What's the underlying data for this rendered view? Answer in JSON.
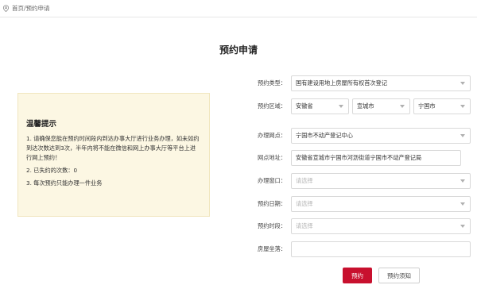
{
  "breadcrumb": {
    "home": "首页",
    "separator": "/",
    "current": "预约申请"
  },
  "page": {
    "title": "预约申请"
  },
  "notice": {
    "title": "温馨提示",
    "items": [
      "1. 请确保您能在预约时间段内到达办事大厅进行业务办理，如未如约到达次数达到3次，半年内将不能在微信和网上办事大厅等平台上进行网上预约！",
      "2. 已失约的次数：0",
      "3. 每次预约只能办理一件业务"
    ]
  },
  "form": {
    "type": {
      "label": "预约类型：",
      "value": "国有建设用地上房屋所有权首次登记"
    },
    "region": {
      "label": "预约区域：",
      "province": "安徽省",
      "city": "宣城市",
      "county": "宁国市"
    },
    "office": {
      "label": "办理网点：",
      "value": "宁国市不动产登记中心"
    },
    "address": {
      "label": "网点地址：",
      "value": "安徽省宣城市宁国市河沥街道宁国市不动产登记局"
    },
    "window": {
      "label": "办理窗口：",
      "placeholder": "请选择"
    },
    "date": {
      "label": "预约日期：",
      "placeholder": "请选择"
    },
    "period": {
      "label": "预约时段：",
      "placeholder": "请选择"
    },
    "location": {
      "label": "房屋坐落：",
      "value": ""
    }
  },
  "actions": {
    "submit": "预约",
    "notice": "预约须知"
  },
  "colors": {
    "primary": "#c8102e",
    "notice_bg": "#fcf7e3"
  }
}
